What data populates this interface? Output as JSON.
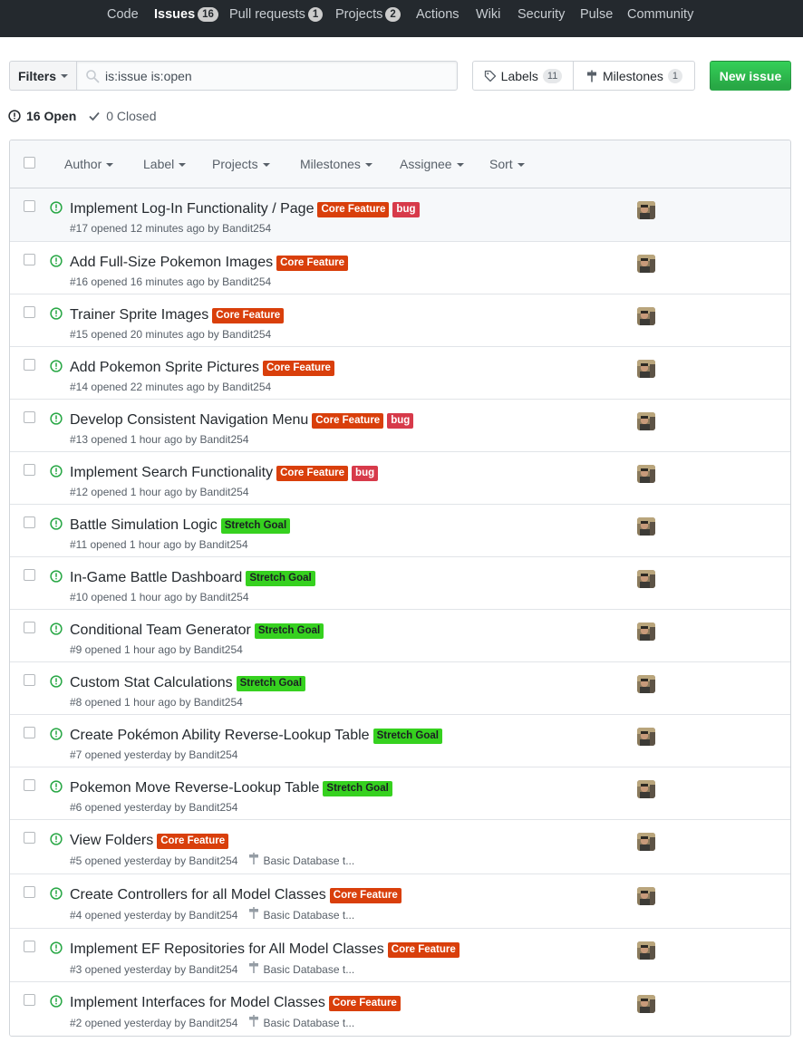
{
  "nav": {
    "items": [
      {
        "label": "Code",
        "count": null
      },
      {
        "label": "Issues",
        "count": "16"
      },
      {
        "label": "Pull requests",
        "count": "1"
      },
      {
        "label": "Projects",
        "count": "2"
      },
      {
        "label": "Actions",
        "count": null
      },
      {
        "label": "Wiki",
        "count": null
      },
      {
        "label": "Security",
        "count": null
      },
      {
        "label": "Pulse",
        "count": null
      },
      {
        "label": "Community",
        "count": null
      }
    ],
    "active": "Issues"
  },
  "toolbar": {
    "filters_label": "Filters",
    "search_value": "is:issue is:open",
    "labels_label": "Labels",
    "labels_count": "11",
    "milestones_label": "Milestones",
    "milestones_count": "1",
    "new_issue_label": "New issue"
  },
  "states": {
    "open_label": "16 Open",
    "closed_label": "0 Closed"
  },
  "header": {
    "filters": [
      "Author",
      "Label",
      "Projects",
      "Milestones",
      "Assignee",
      "Sort"
    ]
  },
  "issues": [
    {
      "title": "Implement Log-In Functionality / Page",
      "labels": [
        "Core Feature",
        "bug"
      ],
      "meta": "#17 opened 12 minutes ago by Bandit254",
      "milestone": ""
    },
    {
      "title": "Add Full-Size Pokemon Images",
      "labels": [
        "Core Feature"
      ],
      "meta": "#16 opened 16 minutes ago by Bandit254",
      "milestone": ""
    },
    {
      "title": "Trainer Sprite Images",
      "labels": [
        "Core Feature"
      ],
      "meta": "#15 opened 20 minutes ago by Bandit254",
      "milestone": ""
    },
    {
      "title": "Add Pokemon Sprite Pictures",
      "labels": [
        "Core Feature"
      ],
      "meta": "#14 opened 22 minutes ago by Bandit254",
      "milestone": ""
    },
    {
      "title": "Develop Consistent Navigation Menu",
      "labels": [
        "Core Feature",
        "bug"
      ],
      "meta": "#13 opened 1 hour ago by Bandit254",
      "milestone": ""
    },
    {
      "title": "Implement Search Functionality",
      "labels": [
        "Core Feature",
        "bug"
      ],
      "meta": "#12 opened 1 hour ago by Bandit254",
      "milestone": ""
    },
    {
      "title": "Battle Simulation Logic",
      "labels": [
        "Stretch Goal"
      ],
      "meta": "#11 opened 1 hour ago by Bandit254",
      "milestone": ""
    },
    {
      "title": "In-Game Battle Dashboard",
      "labels": [
        "Stretch Goal"
      ],
      "meta": "#10 opened 1 hour ago by Bandit254",
      "milestone": ""
    },
    {
      "title": "Conditional Team Generator",
      "labels": [
        "Stretch Goal"
      ],
      "meta": "#9 opened 1 hour ago by Bandit254",
      "milestone": ""
    },
    {
      "title": "Custom Stat Calculations",
      "labels": [
        "Stretch Goal"
      ],
      "meta": "#8 opened 1 hour ago by Bandit254",
      "milestone": ""
    },
    {
      "title": "Create Pokémon Ability Reverse-Lookup Table",
      "labels": [
        "Stretch Goal"
      ],
      "meta": "#7 opened yesterday by Bandit254",
      "milestone": ""
    },
    {
      "title": "Pokemon Move Reverse-Lookup Table",
      "labels": [
        "Stretch Goal"
      ],
      "meta": "#6 opened yesterday by Bandit254",
      "milestone": ""
    },
    {
      "title": "View Folders",
      "labels": [
        "Core Feature"
      ],
      "meta": "#5 opened yesterday by Bandit254",
      "milestone": "Basic Database t..."
    },
    {
      "title": "Create Controllers for all Model Classes",
      "labels": [
        "Core Feature"
      ],
      "meta": "#4 opened yesterday by Bandit254",
      "milestone": "Basic Database t..."
    },
    {
      "title": "Implement EF Repositories for All Model Classes",
      "labels": [
        "Core Feature"
      ],
      "meta": "#3 opened yesterday by Bandit254",
      "milestone": "Basic Database t..."
    },
    {
      "title": "Implement Interfaces for Model Classes",
      "labels": [
        "Core Feature"
      ],
      "meta": "#2 opened yesterday by Bandit254",
      "milestone": "Basic Database t..."
    }
  ],
  "colors": {
    "nav_bg": "#24292e",
    "open_icon": "#28a745",
    "core_feature": "#d93f0b",
    "bug": "#d73a4a",
    "stretch_goal": "#36d11f",
    "new_issue": "#28a745"
  },
  "icons": {
    "search": "search-icon",
    "tag": "tag-icon",
    "milestone": "milestone-icon",
    "issue_open": "issue-opened-icon",
    "check": "check-icon"
  }
}
